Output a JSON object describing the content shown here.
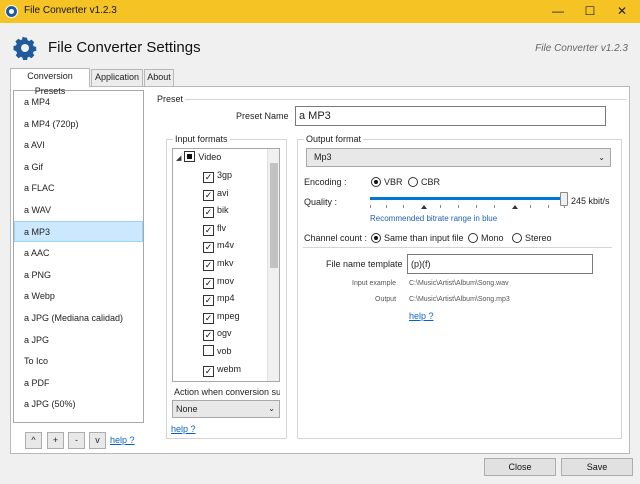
{
  "window": {
    "title": "File Converter v1.2.3",
    "controls": [
      "—",
      "☐",
      "✕"
    ]
  },
  "header": {
    "title": "File Converter Settings",
    "version": "File Converter v1.2.3",
    "icon": "gear-icon",
    "icon_color": "#1e5a9c"
  },
  "tabs": [
    {
      "label": "Conversion Presets",
      "active": true
    },
    {
      "label": "Application",
      "active": false
    },
    {
      "label": "About",
      "active": false
    }
  ],
  "presets": {
    "items": [
      "a MP4",
      "a MP4 (720p)",
      "a AVI",
      "a Gif",
      "a FLAC",
      "a WAV",
      "a MP3",
      "a AAC",
      "a PNG",
      "a Webp",
      "a JPG (Mediana calidad)",
      "a JPG",
      "To Ico",
      "a PDF",
      "a JPG (50%)"
    ],
    "selected": "a MP3",
    "buttons": {
      "up": "^",
      "add": "+",
      "remove": "-",
      "down": "v"
    },
    "help": "help ?"
  },
  "preset": {
    "group_label": "Preset",
    "name_label": "Preset Name",
    "name_value": "a MP3"
  },
  "input_formats": {
    "group_label": "Input formats",
    "root": "Video",
    "items": [
      {
        "label": "3gp",
        "checked": true
      },
      {
        "label": "avi",
        "checked": true
      },
      {
        "label": "bik",
        "checked": true
      },
      {
        "label": "flv",
        "checked": true
      },
      {
        "label": "m4v",
        "checked": true
      },
      {
        "label": "mkv",
        "checked": true
      },
      {
        "label": "mov",
        "checked": true
      },
      {
        "label": "mp4",
        "checked": true
      },
      {
        "label": "mpeg",
        "checked": true
      },
      {
        "label": "ogv",
        "checked": true
      },
      {
        "label": "vob",
        "checked": false
      },
      {
        "label": "webm",
        "checked": true
      }
    ],
    "action_label": "Action when conversion su",
    "action_value": "None",
    "help": "help ?"
  },
  "output_format": {
    "group_label": "Output format",
    "format_value": "Mp3",
    "encoding_label": "Encoding :",
    "encoding_options": [
      "VBR",
      "CBR"
    ],
    "encoding_selected": "VBR",
    "quality_label": "Quality :",
    "quality_value": "245 kbit/s",
    "quality_level": 0.98,
    "quality_hint": "Recommended bitrate range in blue",
    "channel_label": "Channel count :",
    "channel_options": [
      "Same than input file",
      "Mono",
      "Stereo"
    ],
    "channel_selected": "Same than input file",
    "template_label": "File name template",
    "template_value": "(p)(f)",
    "example_label": "Input example",
    "example_value": "C:\\Music\\Artist\\Album\\Song.wav",
    "output_label": "Output",
    "output_value": "C:\\Music\\Artist\\Album\\Song.mp3",
    "help": "help ?"
  },
  "footer": {
    "close_label": "Close",
    "save_label": "Save"
  },
  "colors": {
    "titlebar": "#f6c325",
    "selection": "#cce8ff",
    "link": "#0a64c8",
    "slider": "#0078d7"
  }
}
